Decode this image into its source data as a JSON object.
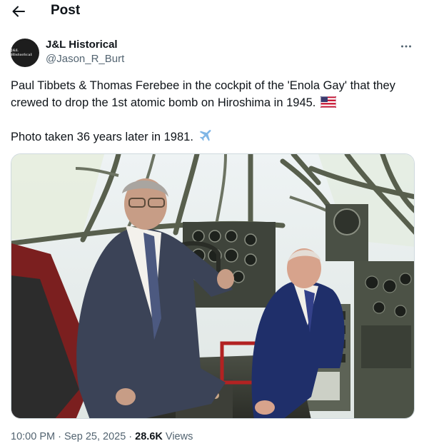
{
  "header": {
    "title": "Post",
    "back_icon": "arrow-left-icon"
  },
  "author": {
    "display_name": "J&L Historical",
    "handle": "@Jason_R_Burt",
    "avatar_text": "J&L Historical"
  },
  "tweet": {
    "line1": "Paul Tibbets & Thomas Ferebee in the cockpit of the 'Enola Gay' that they crewed to drop the 1st atomic bomb on Hiroshima in 1945.",
    "line2": "Photo taken 36 years later in 1981.",
    "emoji1": "us-flag-icon",
    "emoji2": "airplane-icon"
  },
  "meta": {
    "time": "10:00 PM",
    "separator": "·",
    "date": "Sep 25, 2025",
    "views_count": "28.6K",
    "views_label": "Views"
  },
  "colors": {
    "text": "#0f1419",
    "secondary": "#536471",
    "border": "#cfd9de"
  }
}
